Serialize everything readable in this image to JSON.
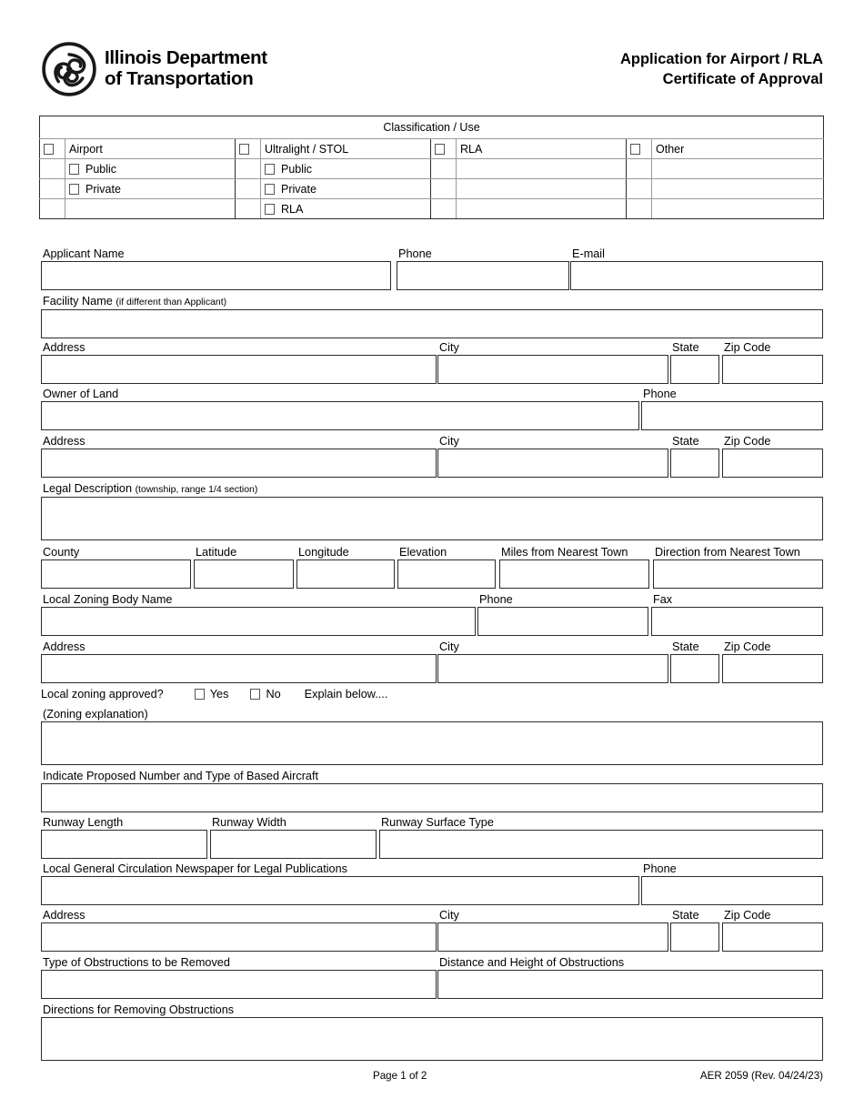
{
  "header": {
    "agency_line1": "Illinois Department",
    "agency_line2": "of Transportation",
    "logo_icon": "idot-triskelion-logo",
    "title_line1": "Application for Airport / RLA",
    "title_line2": "Certificate of Approval"
  },
  "classification": {
    "caption": "Classification / Use",
    "columns": [
      {
        "label": "Airport",
        "sub": [
          "Public",
          "Private",
          ""
        ]
      },
      {
        "label": "Ultralight / STOL",
        "sub": [
          "Public",
          "Private",
          "RLA"
        ]
      },
      {
        "label": "RLA",
        "sub": [
          "",
          "",
          ""
        ]
      },
      {
        "label": "Other",
        "sub": [
          "",
          "",
          ""
        ]
      }
    ]
  },
  "fields": {
    "applicant_name": "Applicant Name",
    "phone": "Phone",
    "email": "E-mail",
    "facility_name": "Facility Name",
    "facility_name_note": "(if different than Applicant)",
    "address": "Address",
    "city": "City",
    "state": "State",
    "zip_code": "Zip Code",
    "owner_of_land": "Owner of Land",
    "legal_description": "Legal Description",
    "legal_description_note": "(township, range 1/4 section)",
    "county": "County",
    "latitude": "Latitude",
    "longitude": "Longitude",
    "elevation": "Elevation",
    "miles_from_nearest_town": "Miles from Nearest Town",
    "direction_from_nearest_town": "Direction from Nearest Town",
    "local_zoning_body_name": "Local Zoning Body Name",
    "fax": "Fax",
    "local_zoning_approved": "Local zoning approved?",
    "yes": "Yes",
    "no": "No",
    "explain_below": "Explain below....",
    "zoning_explanation": "(Zoning explanation)",
    "based_aircraft": "Indicate Proposed Number and Type of Based Aircraft",
    "runway_length": "Runway Length",
    "runway_width": "Runway Width",
    "runway_surface_type": "Runway Surface Type",
    "newspaper": "Local General Circulation Newspaper for Legal Publications",
    "type_of_obstructions": "Type of Obstructions to be Removed",
    "distance_height_obstructions": "Distance and Height of Obstructions",
    "directions_removing_obstructions": "Directions for Removing Obstructions"
  },
  "values": {
    "applicant_name": "",
    "phone": "",
    "email": "",
    "facility_name": "",
    "applicant_address": "",
    "applicant_city": "",
    "applicant_state": "",
    "applicant_zip": "",
    "owner_of_land": "",
    "owner_phone": "",
    "owner_address": "",
    "owner_city": "",
    "owner_state": "",
    "owner_zip": "",
    "legal_description": "",
    "county": "",
    "latitude": "",
    "longitude": "",
    "elevation": "",
    "miles_from_nearest_town": "",
    "direction_from_nearest_town": "",
    "local_zoning_body_name": "",
    "zoning_phone": "",
    "zoning_fax": "",
    "zoning_address": "",
    "zoning_city": "",
    "zoning_state": "",
    "zoning_zip": "",
    "zoning_explanation": "",
    "based_aircraft": "",
    "runway_length": "",
    "runway_width": "",
    "runway_surface_type": "",
    "newspaper": "",
    "newspaper_phone": "",
    "newspaper_address": "",
    "newspaper_city": "",
    "newspaper_state": "",
    "newspaper_zip": "",
    "type_of_obstructions": "",
    "distance_height_obstructions": "",
    "directions_removing_obstructions": ""
  },
  "footer": {
    "page": "Page 1 of 2",
    "form_id": "AER 2059 (Rev. 04/24/23)"
  }
}
